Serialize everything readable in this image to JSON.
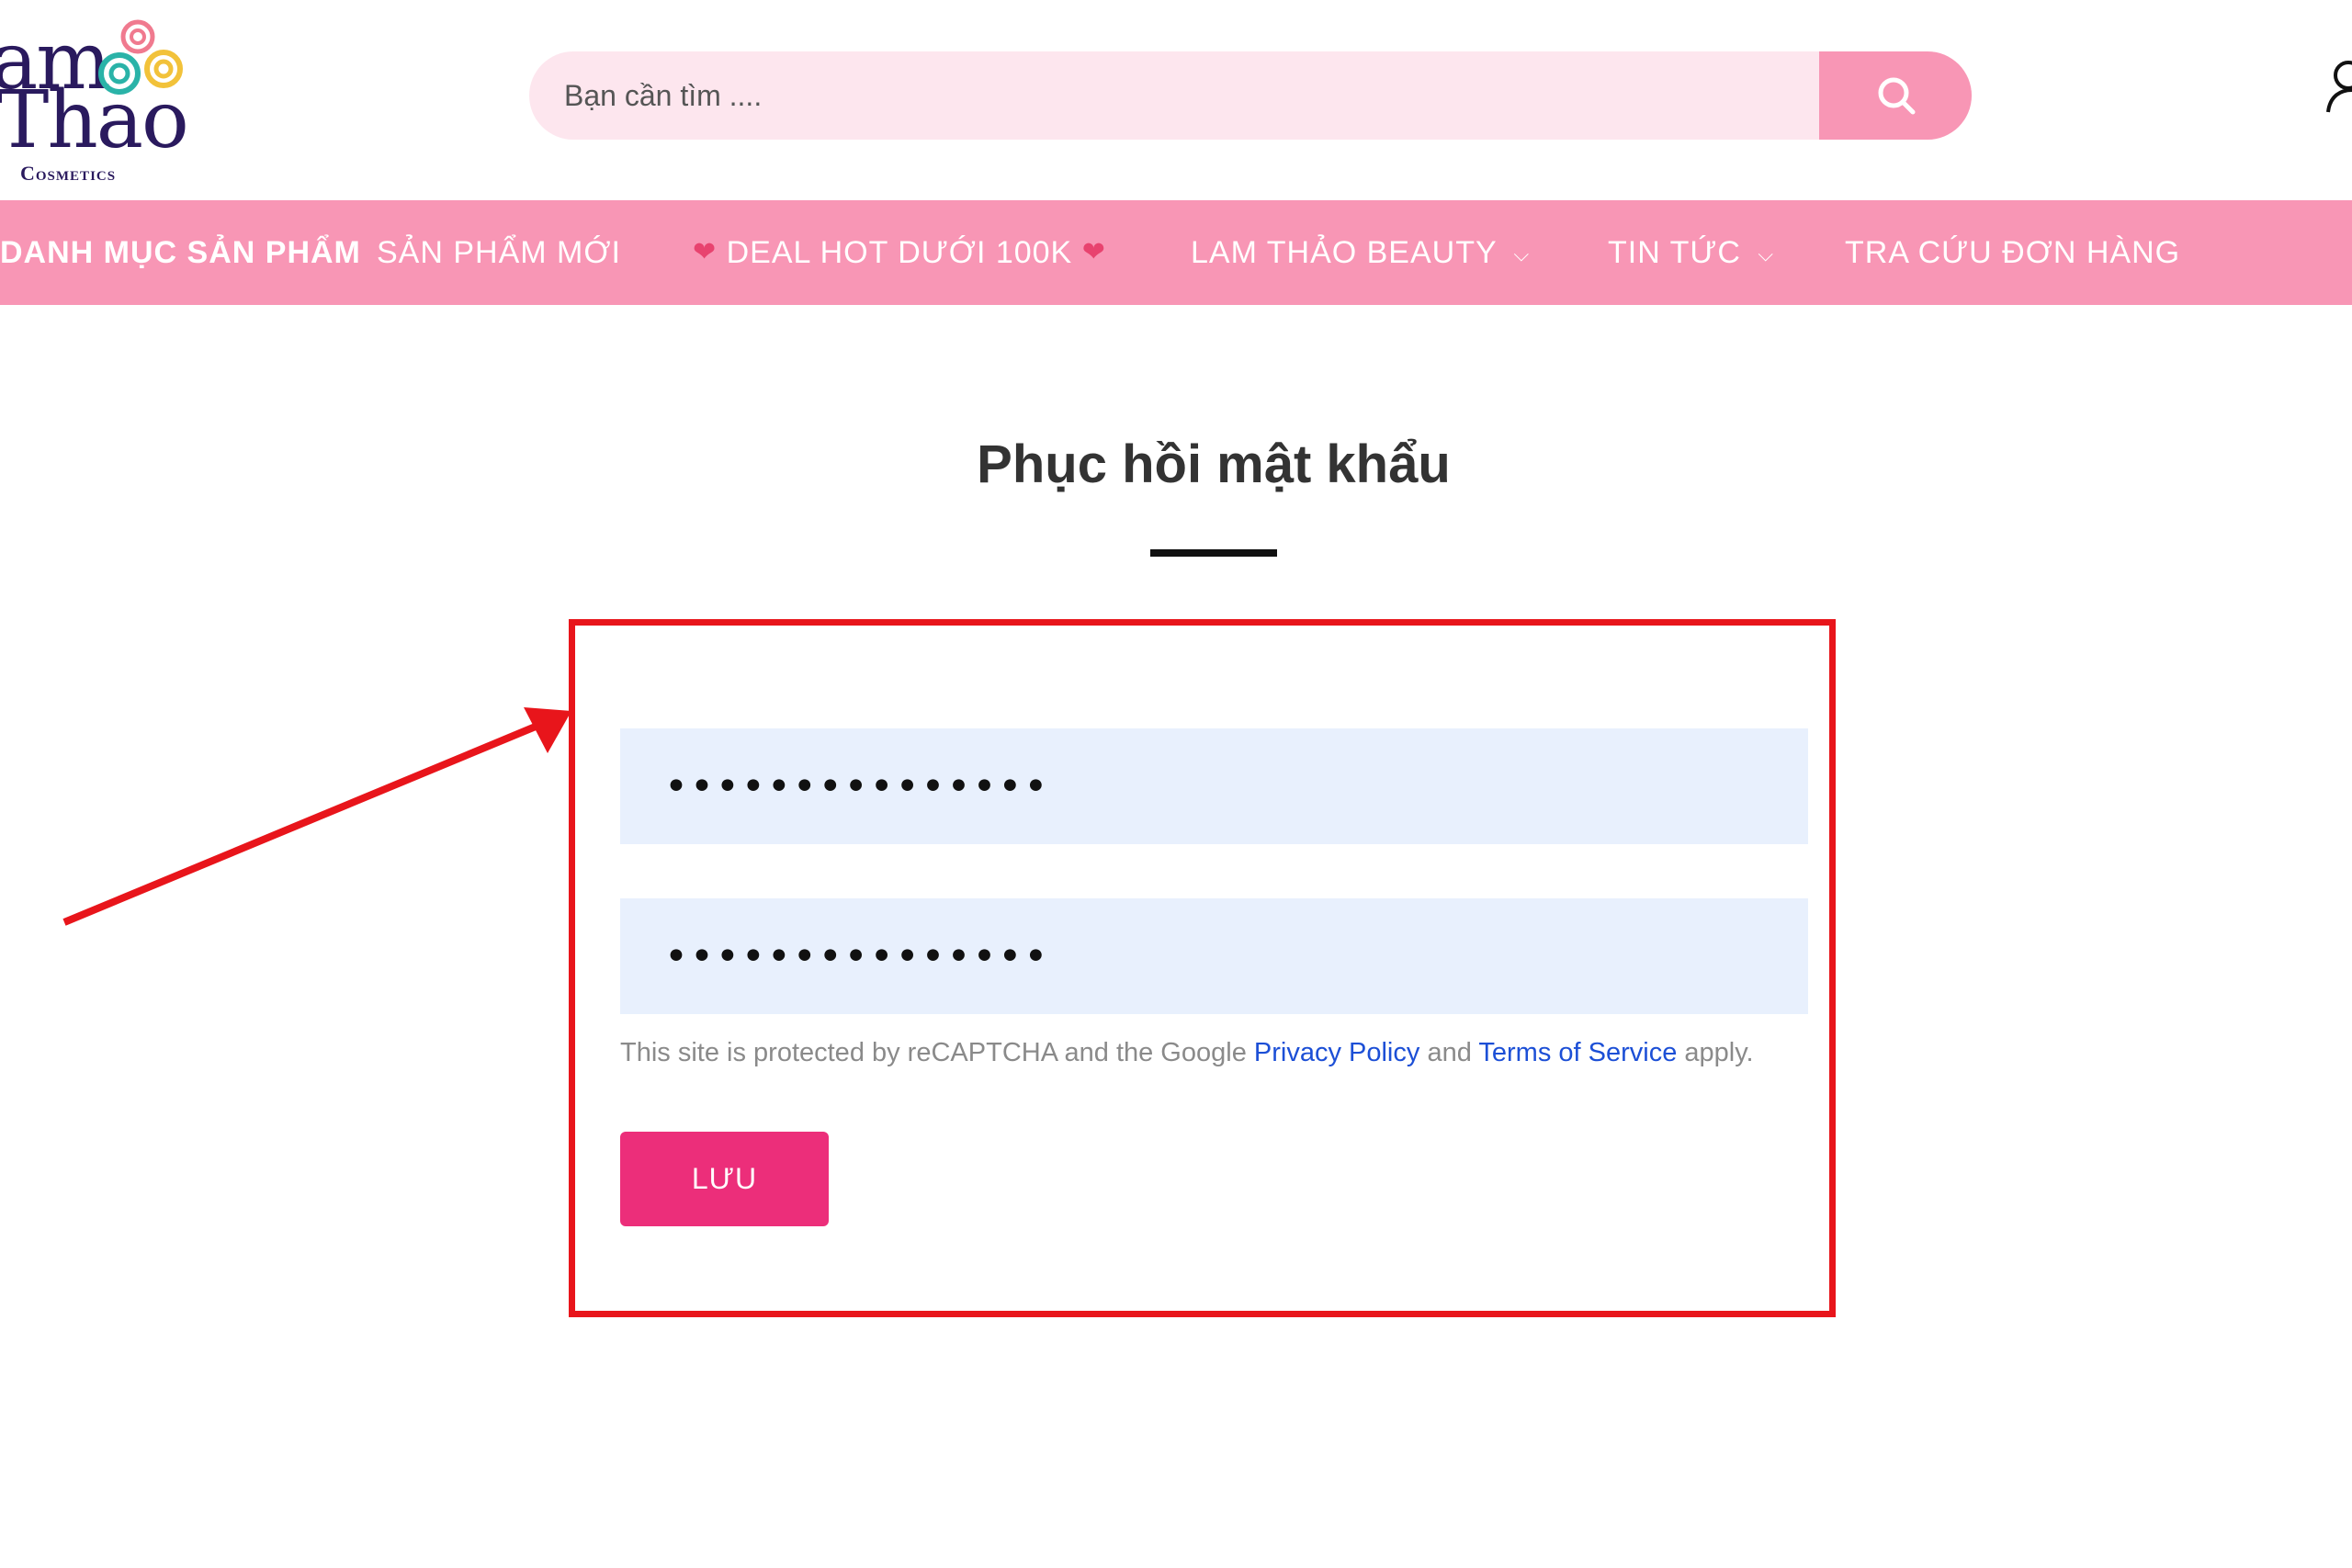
{
  "logo": {
    "line1": "am",
    "line2": "Thao",
    "line3": "Cosmetics"
  },
  "search": {
    "placeholder": "Bạn cần tìm ...."
  },
  "nav": {
    "items": [
      {
        "label": "DANH MỤC SẢN PHẨM"
      },
      {
        "label": "SẢN PHẨM MỚI"
      },
      {
        "label": "DEAL HOT DƯỚI 100K"
      },
      {
        "label": "LAM THẢO BEAUTY"
      },
      {
        "label": "TIN TỨC"
      },
      {
        "label": "TRA CỨU ĐƠN HÀNG"
      }
    ],
    "heart_glyph": "❤",
    "chevron_glyph": "⌵"
  },
  "page": {
    "title": "Phục hồi mật khẩu"
  },
  "form": {
    "password_value": "•••••••••••••••",
    "confirm_password_value": "•••••••••••••••",
    "recaptcha_prefix": "This site is protected by reCAPTCHA and the Google ",
    "privacy_link": "Privacy Policy",
    "recaptcha_and": " and ",
    "terms_link": "Terms of Service",
    "recaptcha_suffix": " apply.",
    "save_label": "LƯU"
  },
  "colors": {
    "brand_pink": "#f896b5",
    "search_bg": "#fde6ee",
    "button_pink": "#ec2e7a",
    "input_bg": "#e8f0fd",
    "annotation_red": "#e8151b",
    "link_blue": "#1c4fd6"
  },
  "icons": {
    "search": "search-icon",
    "account": "user-icon",
    "heart": "heart-icon",
    "chevron": "chevron-down-icon"
  }
}
